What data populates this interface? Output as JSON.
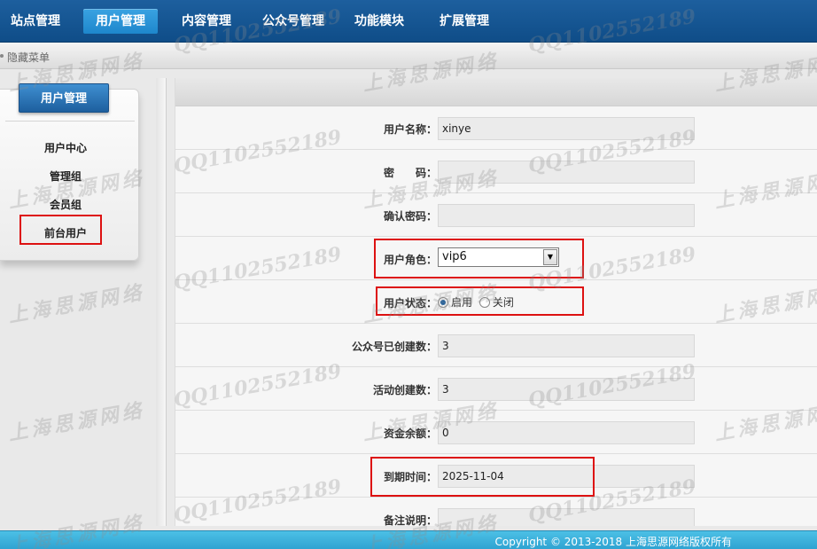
{
  "nav": {
    "items": [
      {
        "label": "站点管理"
      },
      {
        "label": "用户管理"
      },
      {
        "label": "内容管理"
      },
      {
        "label": "公众号管理"
      },
      {
        "label": "功能模块"
      },
      {
        "label": "扩展管理"
      }
    ]
  },
  "subbar": {
    "hide_menu": "隐藏菜单"
  },
  "sidebar": {
    "title": "用户管理",
    "items": [
      {
        "label": "用户中心"
      },
      {
        "label": "管理组"
      },
      {
        "label": "会员组"
      },
      {
        "label": "前台用户"
      }
    ]
  },
  "form": {
    "username_label": "用户名称：",
    "username_value": "xinye",
    "password_label": "密　　码：",
    "password_value": "",
    "confirm_label": "确认密码：",
    "confirm_value": "",
    "role_label": "用户角色：",
    "role_value": "vip6",
    "status_label": "用户状态：",
    "status_options": [
      "启用",
      "关闭"
    ],
    "status_selected": "启用",
    "accounts_label": "公众号已创建数：",
    "accounts_value": "3",
    "activities_label": "活动创建数：",
    "activities_value": "3",
    "balance_label": "资金余额：",
    "balance_value": "0",
    "expiry_label": "到期时间：",
    "expiry_value": "2025-11-04",
    "note_label": "备注说明："
  },
  "footer": {
    "copyright": "Copyright © 2013-2018 上海思源网络版权所有"
  },
  "watermark": {
    "qq": "QQ1102552189",
    "company": "上海思源网络"
  },
  "colors": {
    "nav_bg": "#1d5f9e",
    "nav_active": "#2a96d8",
    "footer_bg": "#3cb3dd",
    "highlight_red": "#dd1111"
  }
}
